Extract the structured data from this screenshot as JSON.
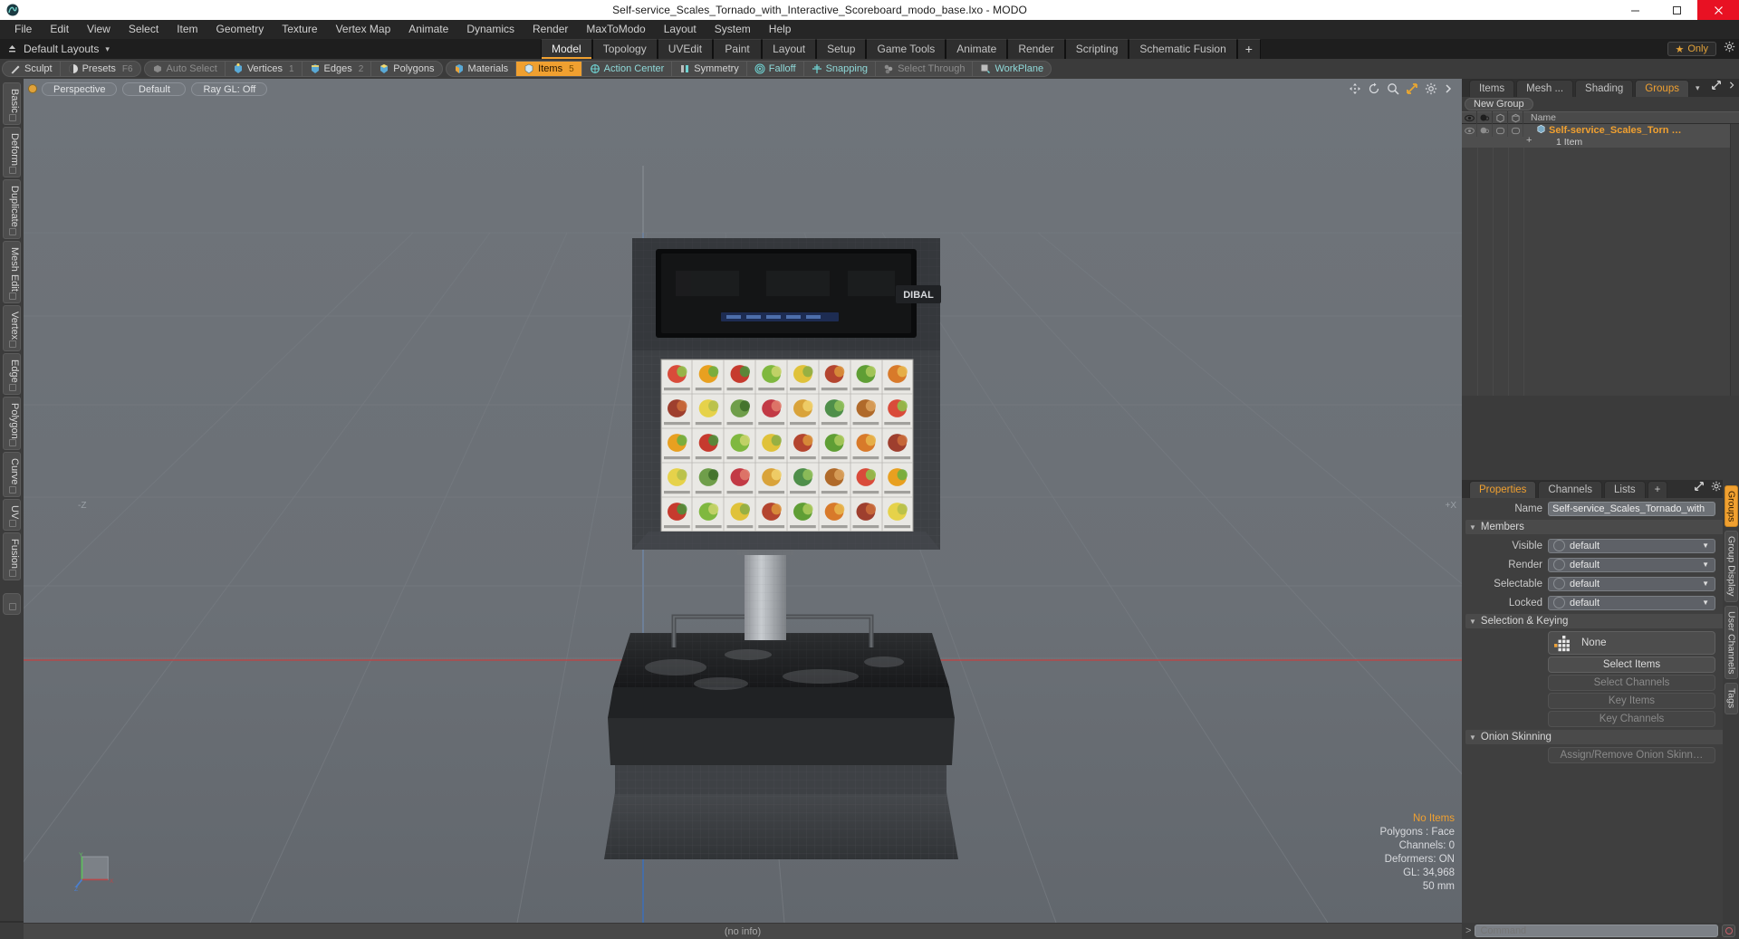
{
  "window": {
    "title": "Self-service_Scales_Tornado_with_Interactive_Scoreboard_modo_base.lxo - MODO",
    "minimize": "–",
    "maximize": "❑",
    "close": "✕"
  },
  "menu": {
    "items": [
      "File",
      "Edit",
      "View",
      "Select",
      "Item",
      "Geometry",
      "Texture",
      "Vertex Map",
      "Animate",
      "Dynamics",
      "Render",
      "MaxToModo",
      "Layout",
      "System",
      "Help"
    ]
  },
  "layoutbar": {
    "layouts_label": "Default Layouts",
    "caret": "▾",
    "tabs": [
      {
        "label": "Model",
        "active": true
      },
      {
        "label": "Topology",
        "active": false
      },
      {
        "label": "UVEdit",
        "active": false
      },
      {
        "label": "Paint",
        "active": false
      },
      {
        "label": "Layout",
        "active": false
      },
      {
        "label": "Setup",
        "active": false
      },
      {
        "label": "Game Tools",
        "active": false
      },
      {
        "label": "Animate",
        "active": false
      },
      {
        "label": "Render",
        "active": false
      },
      {
        "label": "Scripting",
        "active": false
      },
      {
        "label": "Schematic Fusion",
        "active": false
      }
    ],
    "add_tab": "+",
    "only_label": "Only",
    "only_star": "★"
  },
  "modebar": {
    "group1": [
      {
        "label": "Sculpt",
        "icon": "sculpt-icon",
        "state": "normal",
        "num": ""
      },
      {
        "label": "Presets",
        "icon": "presets-icon",
        "state": "normal",
        "num": "F6"
      }
    ],
    "group2": [
      {
        "label": "Auto Select",
        "icon": "autoselect-icon",
        "state": "dim",
        "num": ""
      },
      {
        "label": "Vertices",
        "icon": "vertices-icon",
        "state": "normal",
        "num": "1"
      },
      {
        "label": "Edges",
        "icon": "edges-icon",
        "state": "normal",
        "num": "2"
      },
      {
        "label": "Polygons",
        "icon": "polygons-icon",
        "state": "normal",
        "num": ""
      }
    ],
    "group3": [
      {
        "label": "Materials",
        "icon": "materials-icon",
        "state": "normal",
        "num": ""
      },
      {
        "label": "Items",
        "icon": "items-icon",
        "state": "on",
        "num": "5"
      },
      {
        "label": "Action Center",
        "icon": "action-center-icon",
        "state": "teal",
        "num": ""
      },
      {
        "label": "Symmetry",
        "icon": "symmetry-icon",
        "state": "normal",
        "num": ""
      },
      {
        "label": "Falloff",
        "icon": "falloff-icon",
        "state": "teal",
        "num": ""
      },
      {
        "label": "Snapping",
        "icon": "snapping-icon",
        "state": "teal",
        "num": ""
      },
      {
        "label": "Select Through",
        "icon": "select-through-icon",
        "state": "dim",
        "num": ""
      },
      {
        "label": "WorkPlane",
        "icon": "workplane-icon",
        "state": "teal",
        "num": ""
      }
    ]
  },
  "left_tabs": [
    "Basic",
    "Deform",
    "Duplicate",
    "Mesh Edit",
    "Vertex",
    "Edge",
    "Polygon",
    "Curve",
    "UV",
    "Fusion"
  ],
  "viewport": {
    "view_mode": "Perspective",
    "shading": "Default",
    "raygl": "Ray GL: Off",
    "tool_icons": [
      "move-icon",
      "rotate-icon",
      "zoom-icon",
      "fit-icon",
      "options-icon",
      "more-icon"
    ],
    "stats": {
      "selection": "No Items",
      "polygons": "Polygons : Face",
      "channels": "Channels: 0",
      "deformers": "Deformers: ON",
      "gl": "GL: 34,968",
      "grid": "50 mm"
    },
    "axis": {
      "y": "Y",
      "x": "X",
      "z": "Z"
    },
    "corner_left": "-Z",
    "corner_right": "+X"
  },
  "right_panel": {
    "tabs": [
      {
        "label": "Items",
        "active": false
      },
      {
        "label": "Mesh ...",
        "active": false
      },
      {
        "label": "Shading",
        "active": false
      },
      {
        "label": "Groups",
        "active": true
      }
    ],
    "tabs_caret": "▾",
    "new_group_button": "New Group",
    "tree": {
      "columns": [
        "eye-icon",
        "render-icon",
        "shade-icon",
        "wire-icon"
      ],
      "name_header": "Name",
      "rows": [
        {
          "expand": "+",
          "name": "Self-service_Scales_Torn …",
          "sub": "1 Item"
        }
      ]
    }
  },
  "properties": {
    "tabs": [
      {
        "label": "Properties",
        "active": true
      },
      {
        "label": "Channels",
        "active": false
      },
      {
        "label": "Lists",
        "active": false
      },
      {
        "label": "+",
        "active": false
      }
    ],
    "name_label": "Name",
    "name_value": "Self-service_Scales_Tornado_with",
    "sections": {
      "members": {
        "title": "Members",
        "fields": [
          {
            "label": "Visible",
            "value": "default"
          },
          {
            "label": "Render",
            "value": "default"
          },
          {
            "label": "Selectable",
            "value": "default"
          },
          {
            "label": "Locked",
            "value": "default"
          }
        ]
      },
      "selection_keying": {
        "title": "Selection & Keying",
        "picker_value": "None",
        "buttons": [
          {
            "label": "Select Items",
            "enabled": true
          },
          {
            "label": "Select Channels",
            "enabled": false
          },
          {
            "label": "Key Items",
            "enabled": false
          },
          {
            "label": "Key Channels",
            "enabled": false
          }
        ]
      },
      "onion_skinning": {
        "title": "Onion Skinning",
        "buttons": [
          {
            "label": "Assign/Remove Onion Skinn…",
            "enabled": false
          }
        ]
      }
    },
    "edge_tabs": [
      {
        "label": "Groups",
        "active": true
      },
      {
        "label": "Group Display",
        "active": false
      },
      {
        "label": "User Channels",
        "active": false
      },
      {
        "label": "Tags",
        "active": false
      }
    ]
  },
  "statusbar": {
    "info": "(no info)"
  },
  "commandbar": {
    "caret": ">",
    "placeholder": "Command",
    "record_icon": "record-icon"
  },
  "colors": {
    "accent": "#f0a030",
    "viewport_bg": "#6b7076",
    "panel_bg": "#3b3b3b",
    "teal": "#8fd9d9",
    "close_red": "#e81123"
  }
}
